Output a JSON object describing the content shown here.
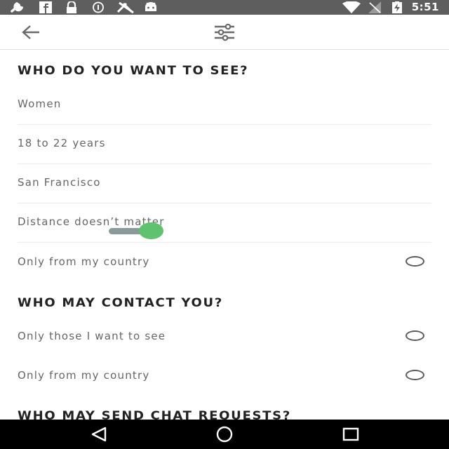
{
  "status_bar": {
    "time": "5:51",
    "left_icons": [
      "wrench-icon",
      "facebook-icon",
      "lock-icon",
      "info-circle-icon",
      "no-wifi-tools-icon",
      "android-icon"
    ],
    "right_icons": [
      "wifi-icon",
      "no-signal-icon",
      "battery-charging-icon"
    ]
  },
  "toolbar": {
    "back_icon": "arrow-left-icon",
    "filter_icon": "sliders-icon"
  },
  "sections": {
    "see": {
      "title": "WHO DO YOU WANT TO SEE?",
      "gender": "Women",
      "age": "18 to 22 years",
      "location": "San Francisco",
      "distance": "Distance doesn’t matter",
      "only_country": "Only from my country"
    },
    "contact": {
      "title": "WHO MAY CONTACT YOU?",
      "only_those": "Only those I want to see",
      "only_country": "Only from my country"
    },
    "chat": {
      "title": "WHO MAY SEND CHAT REQUESTS?"
    }
  },
  "colors": {
    "accent": "#5ec26e",
    "track": "#8a9a9a",
    "status_bar": "#5e5e5e"
  }
}
